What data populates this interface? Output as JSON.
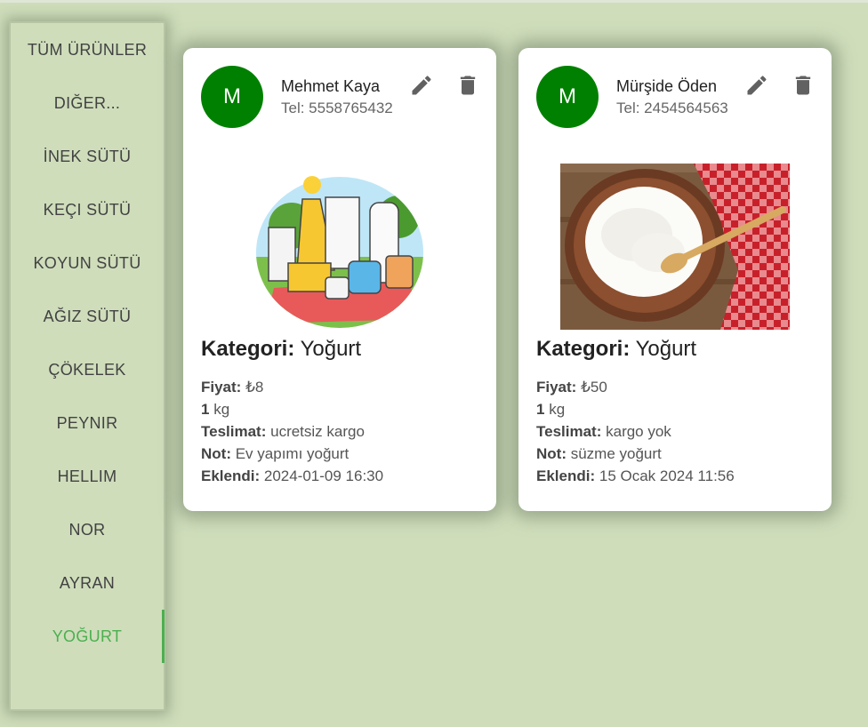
{
  "sidebar": {
    "items": [
      {
        "label": "TÜM ÜRÜNLER"
      },
      {
        "label": "DIĞER..."
      },
      {
        "label": "İNEK SÜTÜ"
      },
      {
        "label": "KEÇI SÜTÜ"
      },
      {
        "label": "KOYUN SÜTÜ"
      },
      {
        "label": "AĞIZ SÜTÜ"
      },
      {
        "label": "ÇÖKELEK"
      },
      {
        "label": "PEYNIR"
      },
      {
        "label": "HELLIM"
      },
      {
        "label": "NOR"
      },
      {
        "label": "AYRAN"
      },
      {
        "label": "YOĞURT",
        "active": true
      }
    ]
  },
  "cards": [
    {
      "avatar_letter": "M",
      "name": "Mehmet Kaya",
      "tel": "Tel: 5558765432",
      "image_icon": "cartoon-dairy-products-illustration",
      "category_label": "Kategori:",
      "category_value": "Yoğurt",
      "price_label": "Fiyat:",
      "price_value": "₺8",
      "qty_value": "1",
      "qty_unit": "kg",
      "delivery_label": "Teslimat:",
      "delivery_value": "ucretsiz kargo",
      "note_label": "Not:",
      "note_value": "Ev yapımı yoğurt",
      "added_label": "Eklendi:",
      "added_value": "2024-01-09 16:30"
    },
    {
      "avatar_letter": "M",
      "name": "Mürşide Öden",
      "tel": "Tel: 2454564563",
      "image_icon": "yogurt-bowl-photo",
      "category_label": "Kategori:",
      "category_value": "Yoğurt",
      "price_label": "Fiyat:",
      "price_value": "₺50",
      "qty_value": "1",
      "qty_unit": "kg",
      "delivery_label": "Teslimat:",
      "delivery_value": "kargo yok",
      "note_label": "Not:",
      "note_value": "süzme yoğurt",
      "added_label": "Eklendi:",
      "added_value": "15 Ocak 2024 11:56"
    }
  ],
  "colors": {
    "background": "#cfddbb",
    "avatar": "#008000",
    "active": "#4caf50",
    "icon": "#616161"
  },
  "icons": {
    "edit": "pencil-icon",
    "delete": "trash-icon"
  }
}
